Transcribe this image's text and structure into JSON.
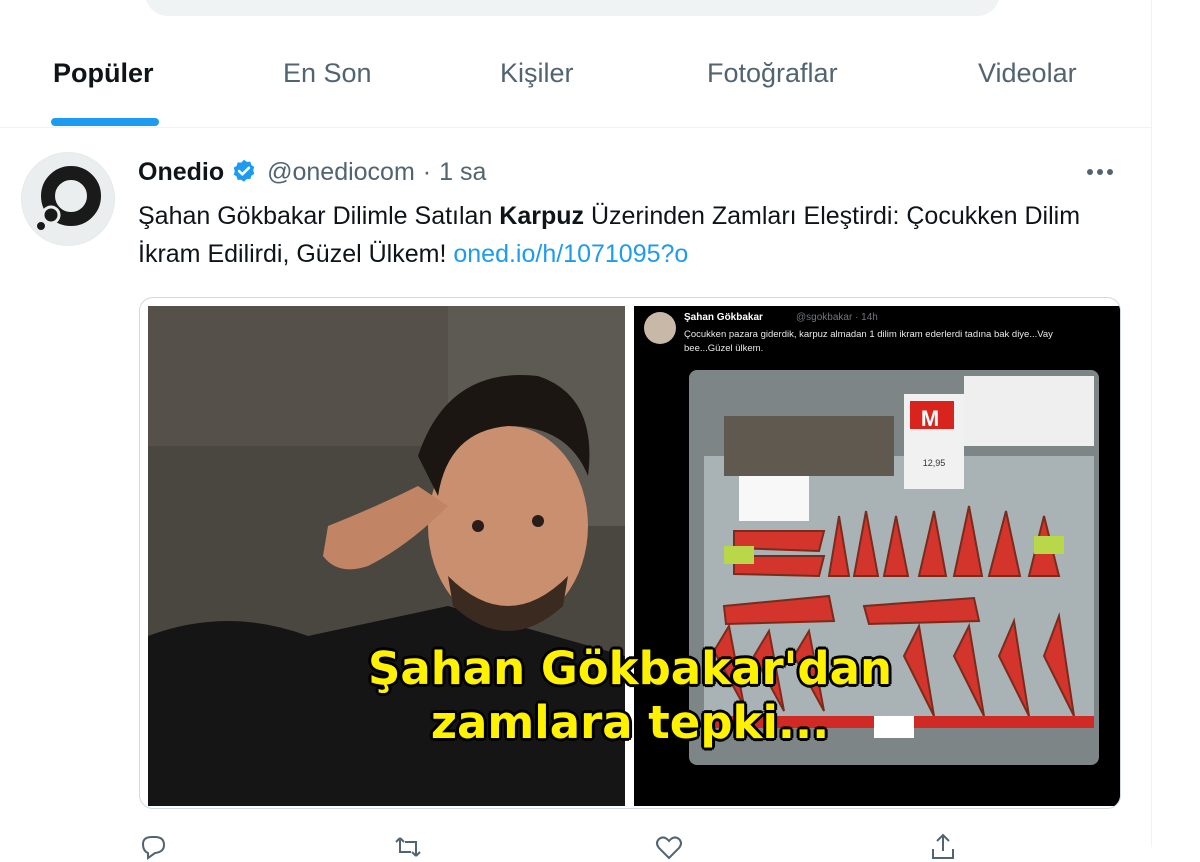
{
  "tabs": [
    "Popüler",
    "En Son",
    "Kişiler",
    "Fotoğraflar",
    "Videolar"
  ],
  "tweet": {
    "author_name": "Onedio",
    "handle": "@onediocom",
    "separator": "·",
    "time": "1 sa",
    "text_part1": "Şahan Gökbakar Dilimle Satılan ",
    "text_bold": "Karpuz",
    "text_part2": " Üzerinden Zamları Eleştirdi: Çocukken Dilim İkram Edilirdi, Güzel Ülkem! ",
    "link": "oned.io/h/1071095?o"
  },
  "media": {
    "caption_line1": "Şahan Gökbakar'dan",
    "caption_line2": "zamlara tepki...",
    "embedded_tweet": {
      "name": "Şahan Gökbakar",
      "handle_time": "@sgokbakar · 14h",
      "text": "Çocukken pazara giderdik, karpuz almadan 1 dilim ikram ederlerdi tadına bak diye...Vay bee...Güzel ülkem.",
      "sign_letter": "M",
      "price": "12,95"
    }
  },
  "icons": {
    "verified": "verified-badge-icon",
    "more": "more-dots-icon",
    "reply": "reply-icon",
    "retweet": "retweet-icon",
    "like": "like-icon",
    "share": "share-icon"
  },
  "colors": {
    "accent": "#1d9bf0",
    "caption": "#fff200"
  }
}
